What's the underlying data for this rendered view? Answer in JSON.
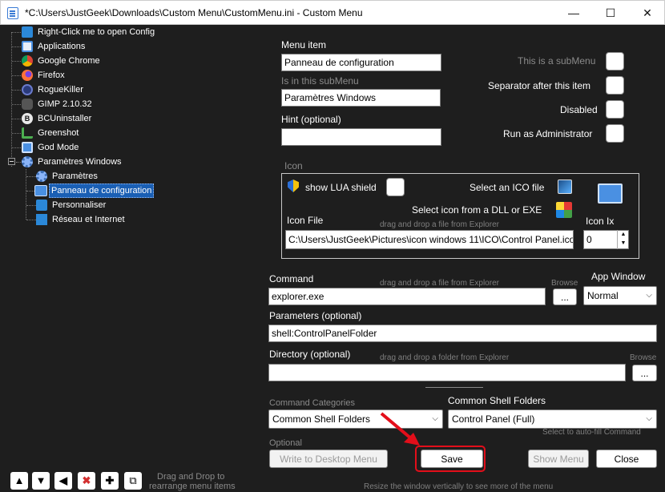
{
  "window": {
    "title": "*C:\\Users\\JustGeek\\Downloads\\Custom Menu\\CustomMenu.ini - Custom Menu",
    "minimize": "—",
    "maximize": "☐",
    "close": "✕"
  },
  "tree": {
    "items": [
      {
        "label": "Right-Click me to open Config",
        "icon": "monitor-icon",
        "color": "#2b88d8"
      },
      {
        "label": "Applications",
        "icon": "apps-icon",
        "color": "#4a90e2"
      },
      {
        "label": "Google Chrome",
        "icon": "chrome-icon",
        "color": "#f4b400"
      },
      {
        "label": "Firefox",
        "icon": "firefox-icon",
        "color": "#ff7139"
      },
      {
        "label": "RogueKiller",
        "icon": "roguekiller-icon",
        "color": "#2a3a7a"
      },
      {
        "label": "GIMP 2.10.32",
        "icon": "gimp-icon",
        "color": "#6b6b6b"
      },
      {
        "label": "BCUninstaller",
        "icon": "bcuninstaller-icon",
        "color": "#e8e8e8"
      },
      {
        "label": "Greenshot",
        "icon": "greenshot-icon",
        "color": "#4caf50"
      },
      {
        "label": "God Mode",
        "icon": "godmode-icon",
        "color": "#4a90e2"
      },
      {
        "label": "Paramètres Windows",
        "icon": "gear-icon",
        "color": "#8ab4f8"
      },
      {
        "label": "Paramètres",
        "icon": "gear-icon",
        "color": "#8ab4f8"
      },
      {
        "label": "Panneau de configuration",
        "icon": "control-panel-icon",
        "color": "#4a90e2"
      },
      {
        "label": "Personnaliser",
        "icon": "personalize-icon",
        "color": "#2b88d8"
      },
      {
        "label": "Réseau et Internet",
        "icon": "network-icon",
        "color": "#2b88d8"
      }
    ]
  },
  "form": {
    "menu_item_label": "Menu item",
    "menu_item_value": "Panneau de configuration",
    "submenu_label": "Is in this subMenu",
    "submenu_value": "Paramètres Windows",
    "hint_label": "Hint (optional)",
    "hint_value": "",
    "is_submenu_label": "This is a subMenu",
    "separator_label": "Separator after this item",
    "disabled_label": "Disabled",
    "run_admin_label": "Run as Administrator"
  },
  "icon_group": {
    "title": "Icon",
    "lua_shield_label": "show LUA shield",
    "select_ico_label": "Select an ICO file",
    "select_dll_label": "Select icon from a DLL or EXE",
    "icon_file_label": "Icon File",
    "drag_hint": "drag and drop a file from Explorer",
    "icon_file_value": "C:\\Users\\JustGeek\\Pictures\\icon windows 11\\ICO\\Control Panel.ico",
    "icon_index_label": "Icon Ix",
    "icon_index_value": "0",
    "spin_up": "▲",
    "spin_down": "▼"
  },
  "command": {
    "label": "Command",
    "drag_hint": "drag and drop a file from Explorer",
    "browse_hint": "Browse",
    "value": "explorer.exe",
    "browse_button": "...",
    "app_window_label": "App Window",
    "app_window_value": "Normal",
    "parameters_label": "Parameters (optional)",
    "parameters_value": "shell:ControlPanelFolder",
    "directory_label": "Directory (optional)",
    "directory_drag_hint": "drag and drop a folder from Explorer",
    "directory_browse_hint": "Browse",
    "directory_value": "",
    "directory_browse_button": "..."
  },
  "categories": {
    "label": "Command Categories",
    "value": "Common Shell Folders",
    "shell_folders_label": "Common Shell Folders",
    "shell_folders_value": "Control Panel (Full)",
    "autofill_hint": "Select to auto-fill Command"
  },
  "bottom": {
    "optional_label": "Optional",
    "write_desktop_button": "Write to Desktop Menu",
    "save_button": "Save",
    "show_menu_button": "Show Menu",
    "close_button": "Close",
    "drag_drop_hint_1": "Drag and Drop to",
    "drag_drop_hint_2": "rearrange menu items",
    "resize_hint": "Resize the window vertically to see more of the menu"
  },
  "toolbar": {
    "up": "▲",
    "down": "▼",
    "left": "◀",
    "delete": "✖",
    "add": "✚",
    "copy": "⧉"
  },
  "colors": {
    "background": "#1e1e1e",
    "selection": "#1a5fb4",
    "highlight": "#e30e1a"
  }
}
